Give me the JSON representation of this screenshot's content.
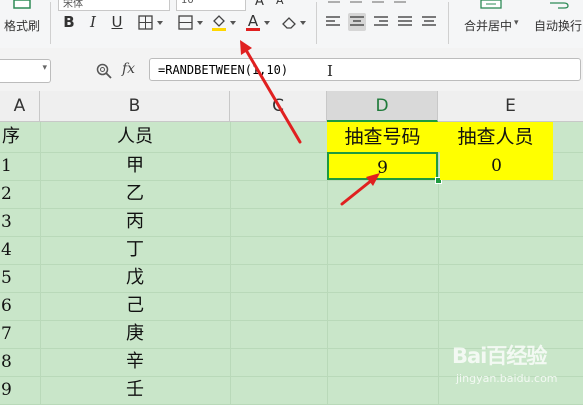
{
  "toolbar": {
    "format_painter_label": "格式刷",
    "font_name": "宋体",
    "font_size": "10",
    "bold_label": "B",
    "italic_label": "I",
    "underline_label": "U",
    "merge_center_label": "合并居中",
    "merge_center_caret": "▾",
    "auto_wrap_label": "自动换行",
    "font_color_letter": "A",
    "grow_font_letter": "A"
  },
  "formula_bar": {
    "fx_label": "fx",
    "formula": "=RANDBETWEEN(1,10)"
  },
  "columns": [
    {
      "letter": "A"
    },
    {
      "letter": "B"
    },
    {
      "letter": "C"
    },
    {
      "letter": "D"
    },
    {
      "letter": "E"
    }
  ],
  "sheet": {
    "header_row": {
      "a": "序",
      "b": "人员",
      "d": "抽查号码",
      "e": "抽查人员"
    },
    "rows": [
      {
        "a": "1",
        "b": "甲",
        "d": "9",
        "e": "0"
      },
      {
        "a": "2",
        "b": "乙"
      },
      {
        "a": "3",
        "b": "丙"
      },
      {
        "a": "4",
        "b": "丁"
      },
      {
        "a": "5",
        "b": "戊"
      },
      {
        "a": "6",
        "b": "己"
      },
      {
        "a": "7",
        "b": "庚"
      },
      {
        "a": "8",
        "b": "辛"
      },
      {
        "a": "9",
        "b": "壬"
      }
    ]
  },
  "colors": {
    "cell_bg": "#c9e6c9",
    "highlight_yellow": "#ffff00",
    "selection_green": "#1f9a3f",
    "annotation_red": "#e02020"
  },
  "watermark": {
    "brand": "Bai百经验",
    "url": "jingyan.baidu.com"
  }
}
